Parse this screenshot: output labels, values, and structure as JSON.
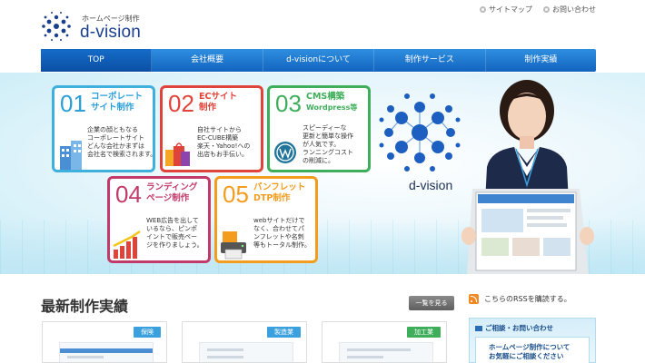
{
  "header": {
    "logo_sub": "ホームページ制作",
    "logo_main": "d-vision",
    "links": [
      {
        "label": "サイトマップ"
      },
      {
        "label": "お問い合わせ"
      }
    ]
  },
  "nav": {
    "items": [
      {
        "label": "TOP",
        "active": true
      },
      {
        "label": "会社概要"
      },
      {
        "label": "d-visionについて"
      },
      {
        "label": "制作サービス"
      },
      {
        "label": "制作実績"
      }
    ]
  },
  "hero": {
    "cards": [
      {
        "num": "01",
        "title_line1": "コーポレート",
        "title_line2": "サイト制作",
        "text": "企業の顔ともなる\nコーポレートサイト\nどんな会社かまずは\n会社名で検索されます。"
      },
      {
        "num": "02",
        "title_line1": "ECサイト",
        "title_line2": "制作",
        "text": "自社サイトから\nEC-CUBE構築\n楽天・Yahoo!への\n出店もお手伝い。"
      },
      {
        "num": "03",
        "title_line1": "CMS構築",
        "title_line2": "Wordpress等",
        "text": "スピーディーな\n更新と簡単な操作\nが人気です。\nランニングコスト\nの削減に。"
      },
      {
        "num": "04",
        "title_line1": "ランディング",
        "title_line2": "ページ制作",
        "text": "WEB広告を出して\nいるなら、ピンポ\nイントで販売ペー\nジを作りましょう。"
      },
      {
        "num": "05",
        "title_line1": "パンフレット",
        "title_line2": "DTP制作",
        "text": "webサイトだけで\nなく、合わせてパ\nンフレットや名刺\n等もトータル制作。"
      }
    ],
    "logo_text": "d-vision"
  },
  "works": {
    "title": "最新制作実績",
    "more_label": "一覧を見る",
    "items": [
      {
        "tag": "保険",
        "tag_color": "#3aa0de"
      },
      {
        "tag": "製造業",
        "tag_color": "#3aa0de"
      },
      {
        "tag": "加工業",
        "tag_color": "#3fae5a"
      }
    ]
  },
  "sidebar": {
    "rss_label": "こちらのRSSを購読する。",
    "contact_title": "ご相談・お問い合わせ",
    "contact_line1": "ホームページ制作について",
    "contact_line2": "お気軽にご相談ください"
  },
  "colors": {
    "nav_blue": "#1a78d2",
    "brand_navy": "#1a3f8f",
    "accent_orange": "#f08a24"
  }
}
